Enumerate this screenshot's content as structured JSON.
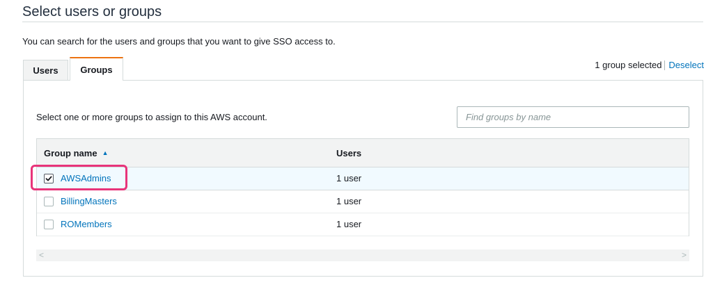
{
  "page": {
    "title": "Select users or groups",
    "intro": "You can search for the users and groups that you want to give SSO access to."
  },
  "tabs": [
    {
      "label": "Users",
      "active": false
    },
    {
      "label": "Groups",
      "active": true
    }
  ],
  "selection": {
    "count_text": "1 group selected",
    "deselect_label": "Deselect"
  },
  "groups_panel": {
    "helper_text": "Select one or more groups to assign to this AWS account.",
    "search_placeholder": "Find groups by name",
    "search_value": ""
  },
  "table": {
    "columns": [
      "Group name",
      "Users"
    ],
    "sort": {
      "column": "Group name",
      "direction": "ascending",
      "icon": "triangle-up-icon"
    },
    "rows": [
      {
        "name": "AWSAdmins",
        "users": "1 user",
        "checked": true
      },
      {
        "name": "BillingMasters",
        "users": "1 user",
        "checked": false
      },
      {
        "name": "ROMembers",
        "users": "1 user",
        "checked": false
      }
    ]
  },
  "scrollbar": {
    "left_icon": "chevron-left-icon",
    "right_icon": "chevron-right-icon"
  },
  "colors": {
    "accent_tab": "#ec7211",
    "link": "#0073bb",
    "highlight": "#e8347a",
    "selected_row": "#f1faff"
  }
}
